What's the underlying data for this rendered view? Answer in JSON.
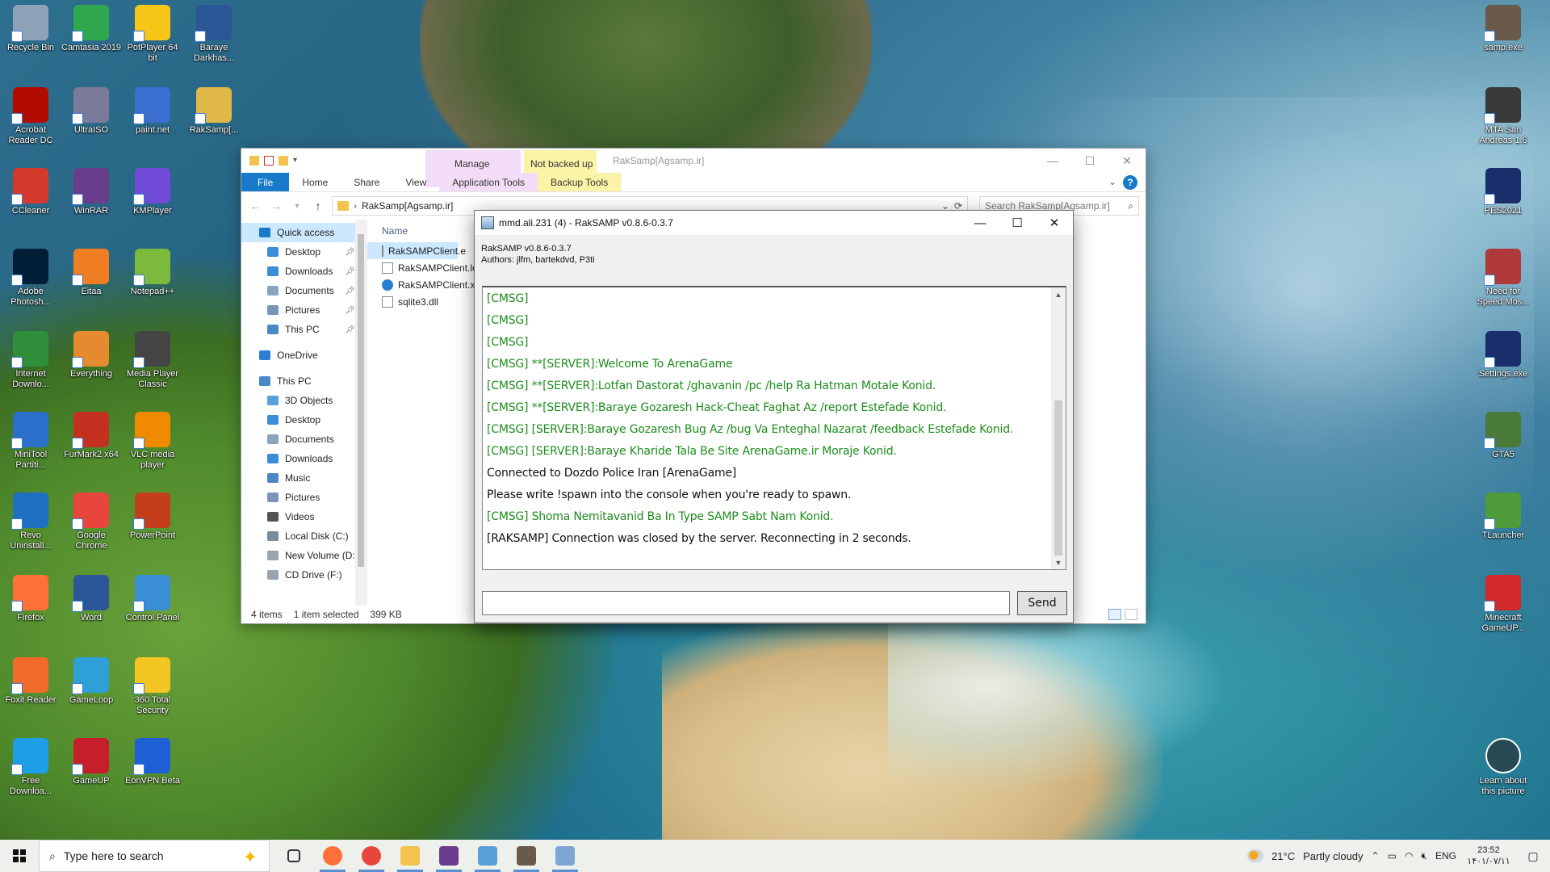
{
  "desktop": {
    "icons_left": [
      {
        "label": "Recycle Bin",
        "color": "#8fa3b8"
      },
      {
        "label": "Camtasia 2019",
        "color": "#2fa84f"
      },
      {
        "label": "PotPlayer 64 bit",
        "color": "#f5c518"
      },
      {
        "label": "Baraye Darkhas...",
        "color": "#2b5797"
      },
      {
        "label": "Acrobat Reader DC",
        "color": "#b30b00"
      },
      {
        "label": "UltraISO",
        "color": "#7a7a9a"
      },
      {
        "label": "paint.net",
        "color": "#3b6fcf"
      },
      {
        "label": "RakSamp[...",
        "color": "#e0b84a"
      },
      {
        "label": "CCleaner",
        "color": "#d33a2c"
      },
      {
        "label": "WinRAR",
        "color": "#6a3c8c"
      },
      {
        "label": "KMPlayer",
        "color": "#6f4bd8"
      },
      {
        "label": "Adobe Photosh...",
        "color": "#001e36"
      },
      {
        "label": "Eitaa",
        "color": "#f07f24"
      },
      {
        "label": "Notepad++",
        "color": "#7cba3d"
      },
      {
        "label": "Internet Downlo...",
        "color": "#2f8f3a"
      },
      {
        "label": "Everything",
        "color": "#e58a2e"
      },
      {
        "label": "Media Player Classic",
        "color": "#444444"
      },
      {
        "label": "MiniTool Partiti...",
        "color": "#2a6fc9"
      },
      {
        "label": "FurMark2 x64",
        "color": "#c4301f"
      },
      {
        "label": "VLC media player",
        "color": "#f08a00"
      },
      {
        "label": "Revo Uninstall...",
        "color": "#1f6fc2"
      },
      {
        "label": "Google Chrome",
        "color": "#e8453c"
      },
      {
        "label": "PowerPoint",
        "color": "#c43e1c"
      },
      {
        "label": "Firefox",
        "color": "#ff7139"
      },
      {
        "label": "Word",
        "color": "#2b579a"
      },
      {
        "label": "Control Panel",
        "color": "#3a8ed8"
      },
      {
        "label": "Foxit Reader",
        "color": "#f26a2a"
      },
      {
        "label": "GameLoop",
        "color": "#2da0d8"
      },
      {
        "label": "360 Total Security",
        "color": "#f3c623"
      },
      {
        "label": "Free Downloa...",
        "color": "#1ea0e6"
      },
      {
        "label": "GameUP",
        "color": "#c61f2c"
      },
      {
        "label": "EonVPN Beta",
        "color": "#1e5fd6"
      }
    ],
    "icons_right": [
      {
        "label": "samp.exe",
        "color": "#6a5a4a"
      },
      {
        "label": "MTA San Andreas 1.6",
        "color": "#3a3a3a"
      },
      {
        "label": "PES2021",
        "color": "#1a2e6c"
      },
      {
        "label": "Need for Speed Mos...",
        "color": "#b03a3a"
      },
      {
        "label": "Settings.exe",
        "color": "#1a2e6c"
      },
      {
        "label": "GTA5",
        "color": "#4a7a3a"
      },
      {
        "label": "TLauncher",
        "color": "#4f9a3a"
      },
      {
        "label": "Minecraft GameUP...",
        "color": "#d22a2a"
      },
      {
        "label": "Learn about this picture",
        "color": "#555555"
      }
    ]
  },
  "explorer": {
    "context_manage": "Manage",
    "context_backup": "Not backed up",
    "title": "RakSamp[Agsamp.ir]",
    "tabs": [
      "File",
      "Home",
      "Share",
      "View",
      "Application Tools",
      "Backup Tools"
    ],
    "address": "RakSamp[Agsamp.ir]",
    "search_placeholder": "Search RakSamp[Agsamp.ir]",
    "nav": [
      {
        "label": "Quick access",
        "indent": 0,
        "color": "#1979ca",
        "pin": false,
        "sel": true
      },
      {
        "label": "Desktop",
        "indent": 1,
        "color": "#3a8ed8",
        "pin": true
      },
      {
        "label": "Downloads",
        "indent": 1,
        "color": "#3a8ed8",
        "pin": true
      },
      {
        "label": "Documents",
        "indent": 1,
        "color": "#8aa4c0",
        "pin": true
      },
      {
        "label": "Pictures",
        "indent": 1,
        "color": "#7a95b8",
        "pin": true
      },
      {
        "label": "This PC",
        "indent": 1,
        "color": "#4a88c8",
        "pin": true
      },
      {
        "label": "OneDrive",
        "indent": 0,
        "color": "#2a7fd0",
        "pin": false
      },
      {
        "label": "This PC",
        "indent": 0,
        "color": "#4a88c8",
        "pin": false
      },
      {
        "label": "3D Objects",
        "indent": 1,
        "color": "#5aa0d8",
        "pin": false
      },
      {
        "label": "Desktop",
        "indent": 1,
        "color": "#3a8ed8",
        "pin": false
      },
      {
        "label": "Documents",
        "indent": 1,
        "color": "#8aa4c0",
        "pin": false
      },
      {
        "label": "Downloads",
        "indent": 1,
        "color": "#3a8ed8",
        "pin": false
      },
      {
        "label": "Music",
        "indent": 1,
        "color": "#4a88c8",
        "pin": false
      },
      {
        "label": "Pictures",
        "indent": 1,
        "color": "#7a95b8",
        "pin": false
      },
      {
        "label": "Videos",
        "indent": 1,
        "color": "#555555",
        "pin": false
      },
      {
        "label": "Local Disk (C:)",
        "indent": 1,
        "color": "#7a8a9a",
        "pin": false
      },
      {
        "label": "New Volume (D:",
        "indent": 1,
        "color": "#9aa4ae",
        "pin": false
      },
      {
        "label": "CD Drive (F:)",
        "indent": 1,
        "color": "#9aa4ae",
        "pin": false
      }
    ],
    "column_name": "Name",
    "files": [
      "RakSAMPClient.e",
      "RakSAMPClient.lo",
      "RakSAMPClient.x",
      "sqlite3.dll"
    ],
    "status_items": "4 items",
    "status_selected": "1 item selected",
    "status_size": "399 KB"
  },
  "raksamp": {
    "title": "mmd.ali.231 (4) - RakSAMP v0.8.6-0.3.7",
    "version": "RakSAMP v0.8.6-0.3.7",
    "authors": "Authors: jlfm, bartekdvd, P3ti",
    "console_lines": [
      {
        "text": "[CMSG]",
        "color": "green"
      },
      {
        "text": "[CMSG]",
        "color": "green"
      },
      {
        "text": "[CMSG]",
        "color": "green"
      },
      {
        "text": "[CMSG] **[SERVER]:Welcome To ArenaGame",
        "color": "green"
      },
      {
        "text": "[CMSG] **[SERVER]:Lotfan Dastorat /ghavanin /pc /help Ra Hatman Motale Konid.",
        "color": "green"
      },
      {
        "text": "[CMSG] **[SERVER]:Baraye Gozaresh Hack-Cheat Faghat Az /report Estefade Konid.",
        "color": "green"
      },
      {
        "text": "[CMSG] [SERVER]:Baraye Gozaresh Bug Az /bug Va Enteghal Nazarat /feedback Estefade Konid.",
        "color": "green"
      },
      {
        "text": "[CMSG] [SERVER]:Baraye Kharide Tala Be Site ArenaGame.ir Moraje Konid.",
        "color": "green"
      },
      {
        "text": "Connected to Dozdo Police Iran [ArenaGame]",
        "color": "black"
      },
      {
        "text": "Please write !spawn into the console when you're ready to spawn.",
        "color": "black"
      },
      {
        "text": "[CMSG] Shoma Nemitavanid Ba In Type SAMP Sabt Nam Konid.",
        "color": "green"
      },
      {
        "text": "[RAKSAMP] Connection was closed by the server. Reconnecting in 2 seconds.",
        "color": "black"
      }
    ],
    "input_value": "",
    "send_label": "Send"
  },
  "taskbar": {
    "search_placeholder": "Type here to search",
    "apps": [
      {
        "name": "task-view",
        "color": "#333333"
      },
      {
        "name": "firefox",
        "color": "#ff7139"
      },
      {
        "name": "chrome",
        "color": "#e8453c"
      },
      {
        "name": "file-explorer",
        "color": "#f2c44e"
      },
      {
        "name": "winrar",
        "color": "#6a3c8c"
      },
      {
        "name": "notepad",
        "color": "#5aa0d8"
      },
      {
        "name": "samp",
        "color": "#6a5a4a"
      },
      {
        "name": "raksamp",
        "color": "#7da6d4"
      }
    ],
    "weather_temp": "21°C",
    "weather_text": "Partly cloudy",
    "lang": "ENG",
    "time": "23:52",
    "date": "۱۴۰۱/۰۷/۱۱"
  }
}
